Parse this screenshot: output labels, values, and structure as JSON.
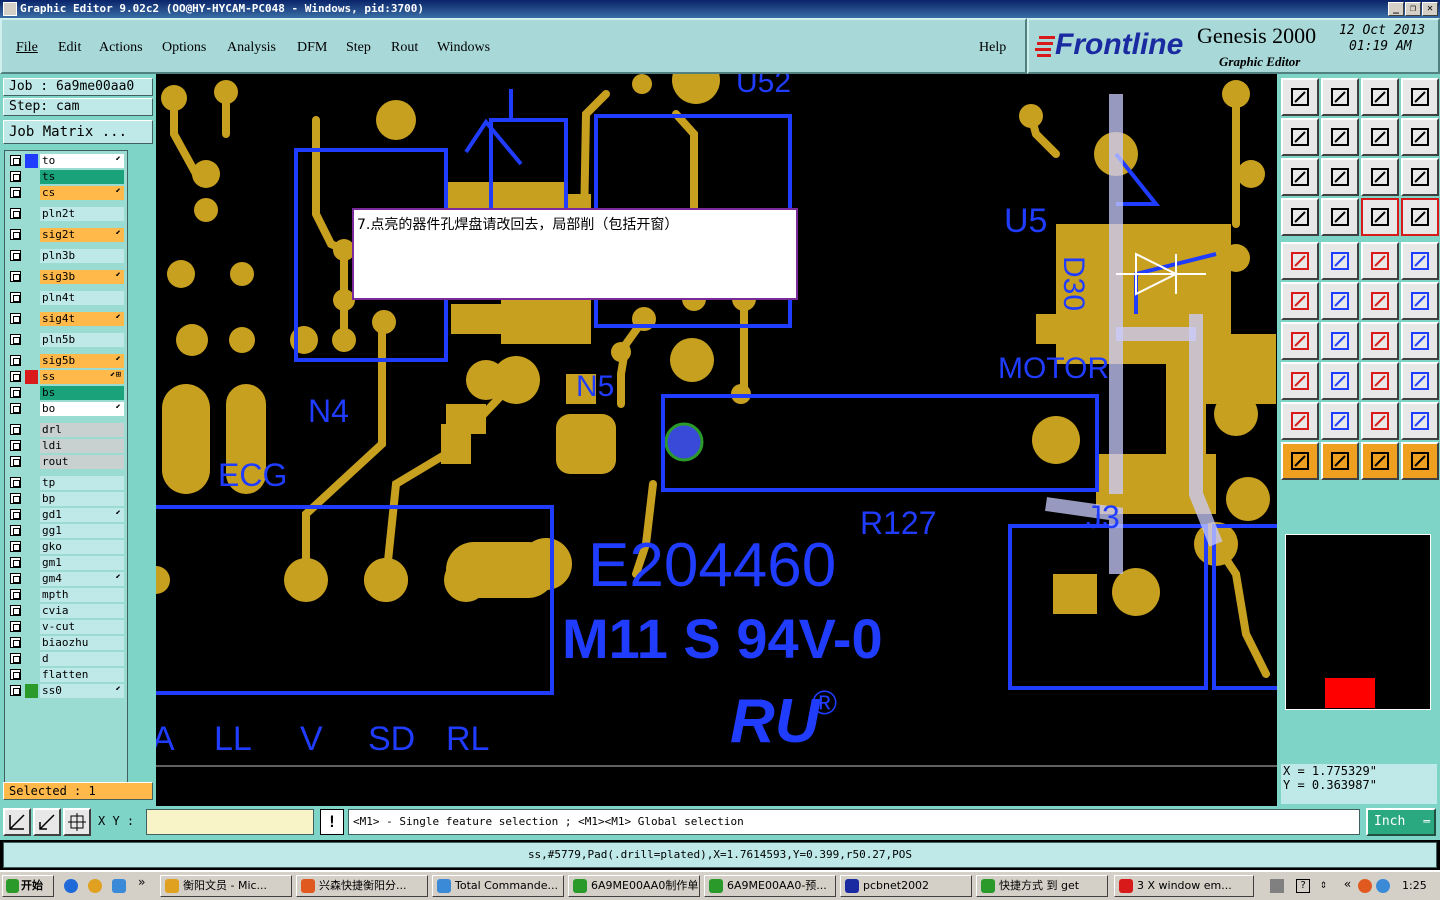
{
  "window": {
    "title": "Graphic Editor 9.02c2  (OO@HY-HYCAM-PC048 - Windows, pid:3700)",
    "controls": [
      "_",
      "❐",
      "✕"
    ]
  },
  "menu": {
    "items": [
      "File",
      "Edit",
      "Actions",
      "Options",
      "Analysis",
      "DFM",
      "Step",
      "Rout",
      "Windows"
    ],
    "help": "Help"
  },
  "brand": {
    "logo": "Frontline",
    "product": "Genesis 2000",
    "subtitle": "Graphic Editor",
    "date": "12  Oct  2013",
    "time": "01:19  AM"
  },
  "job": {
    "job_label": "Job :  6a9me00aa0",
    "step_label": "Step:  cam",
    "matrix_button": "Job Matrix ..."
  },
  "layers": [
    {
      "name": "to",
      "color": "#ffffff",
      "swatch": "#1f3cff",
      "aff": "⬋"
    },
    {
      "name": "ts",
      "color": "#1aa37a",
      "swatch": "",
      "aff": ""
    },
    {
      "name": "cs",
      "color": "#ffb84a",
      "swatch": "",
      "aff": "⬋"
    },
    {
      "name": "pln2t",
      "color": "#bfe8e8",
      "swatch": "",
      "aff": ""
    },
    {
      "name": "sig2t",
      "color": "#ffb84a",
      "swatch": "",
      "aff": "⬋"
    },
    {
      "name": "pln3b",
      "color": "#bfe8e8",
      "swatch": "",
      "aff": ""
    },
    {
      "name": "sig3b",
      "color": "#ffb84a",
      "swatch": "",
      "aff": "⬋"
    },
    {
      "name": "pln4t",
      "color": "#bfe8e8",
      "swatch": "",
      "aff": ""
    },
    {
      "name": "sig4t",
      "color": "#ffb84a",
      "swatch": "",
      "aff": "⬋"
    },
    {
      "name": "pln5b",
      "color": "#bfe8e8",
      "swatch": "",
      "aff": ""
    },
    {
      "name": "sig5b",
      "color": "#ffb84a",
      "swatch": "",
      "aff": "⬋"
    },
    {
      "name": "ss",
      "color": "#ffb84a",
      "swatch": "#d81a1a",
      "aff": "⬋⊞"
    },
    {
      "name": "bs",
      "color": "#1aa37a",
      "swatch": "",
      "aff": ""
    },
    {
      "name": "bo",
      "color": "#ffffff",
      "swatch": "",
      "aff": "⬋"
    },
    {
      "name": "drl",
      "color": "#c8d0d0",
      "swatch": "",
      "aff": ""
    },
    {
      "name": "ldi",
      "color": "#c8d0d0",
      "swatch": "",
      "aff": ""
    },
    {
      "name": "rout",
      "color": "#c8d0d0",
      "swatch": "",
      "aff": ""
    },
    {
      "name": "tp",
      "color": "#bfe8e8",
      "swatch": "",
      "aff": ""
    },
    {
      "name": "bp",
      "color": "#bfe8e8",
      "swatch": "",
      "aff": ""
    },
    {
      "name": "gd1",
      "color": "#bfe8e8",
      "swatch": "",
      "aff": "⬋"
    },
    {
      "name": "gg1",
      "color": "#bfe8e8",
      "swatch": "",
      "aff": ""
    },
    {
      "name": "gko",
      "color": "#bfe8e8",
      "swatch": "",
      "aff": ""
    },
    {
      "name": "gm1",
      "color": "#bfe8e8",
      "swatch": "",
      "aff": ""
    },
    {
      "name": "gm4",
      "color": "#bfe8e8",
      "swatch": "",
      "aff": "⬋"
    },
    {
      "name": "mpth",
      "color": "#bfe8e8",
      "swatch": "",
      "aff": ""
    },
    {
      "name": "cvia",
      "color": "#bfe8e8",
      "swatch": "",
      "aff": ""
    },
    {
      "name": "v-cut",
      "color": "#bfe8e8",
      "swatch": "",
      "aff": ""
    },
    {
      "name": "biaozhu",
      "color": "#bfe8e8",
      "swatch": "",
      "aff": ""
    },
    {
      "name": "d",
      "color": "#bfe8e8",
      "swatch": "",
      "aff": ""
    },
    {
      "name": "flatten",
      "color": "#bfe8e8",
      "swatch": "",
      "aff": ""
    },
    {
      "name": "ss0",
      "color": "#bfe8e8",
      "swatch": "#2a9a2a",
      "aff": "⬋"
    }
  ],
  "selected_label": "Selected : 1",
  "canvas": {
    "note": "7.点亮的器件孔焊盘请改回去，局部削（包括开窗）",
    "labels": [
      "U52",
      "N4",
      "N5",
      "ECG",
      "U5",
      "D30",
      "MOTOR",
      "R127",
      "J3",
      "E204460",
      "M11 S 94V-0",
      "A",
      "LL",
      "V",
      "SD",
      "RL"
    ],
    "logo_text": "RU",
    "registered": "®"
  },
  "coords": {
    "x": "X  =  1.775329\"",
    "y": "Y  =  0.363987\""
  },
  "bottom": {
    "xy_label": "X Y :",
    "xy_value": "",
    "message": "<M1> - Single feature selection ; <M1><M1> Global selection",
    "units": "Inch",
    "warn": "!"
  },
  "status": "ss,#5779,Pad(.drill=plated),X=1.7614593,Y=0.399,r50.27,POS",
  "taskbar": {
    "start": "开始",
    "tasks": [
      "衡阳文员 - Mic...",
      "兴森快捷衡阳分...",
      "Total Commande...",
      "6A9ME00AA0制作单",
      "6A9ME00AA0-预...",
      "pcbnet2002",
      "快捷方式 到 get",
      "3 X window em..."
    ],
    "clock": "1:25"
  },
  "colors": {
    "copper": "#c8a020",
    "silk": "#1f3cff",
    "panel": "#7fd4c8",
    "field": "#bfe8e8"
  }
}
